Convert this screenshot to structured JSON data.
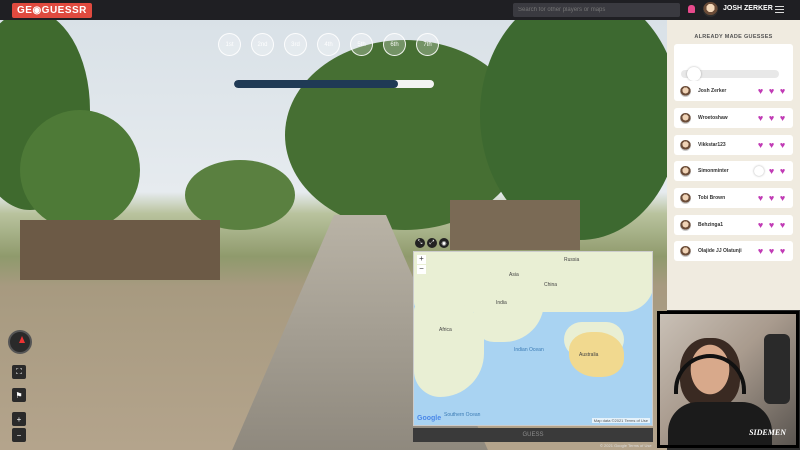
{
  "app": {
    "logo": "GE◉GUESSR",
    "search_placeholder": "Search for other players or maps",
    "username": "JOSH ZERKER"
  },
  "rounds": [
    "1st",
    "2nd",
    "3rd",
    "4th",
    "5th",
    "6th",
    "7th"
  ],
  "timer": {
    "progress": 0.82
  },
  "map": {
    "tools": [
      "⤡",
      "⤢",
      "◉"
    ],
    "zoom_in": "+",
    "zoom_out": "−",
    "labels": {
      "africa": "Africa",
      "asia": "Asia",
      "indian_ocean": "Indian Ocean",
      "australia": "Australia",
      "southern_ocean": "Southern Ocean",
      "russia": "Russia",
      "china": "China",
      "india": "India"
    },
    "google": "Google",
    "footer": "Map data ©2021   Terms of Use",
    "copyright": "© 2021 Google   Terms of Use"
  },
  "guess_button": "GUESS",
  "controls": {
    "flag": "⚑",
    "zoom_in": "+",
    "zoom_out": "−",
    "fullscreen": "⛶"
  },
  "panel": {
    "title": "ALREADY MADE GUESSES",
    "players": [
      {
        "name": "Josh Zerker",
        "hearts": 3,
        "toggle": false
      },
      {
        "name": "Wroetoshaw",
        "hearts": 3,
        "toggle": false
      },
      {
        "name": "Vikkstar123",
        "hearts": 3,
        "toggle": false
      },
      {
        "name": "Simonminter",
        "hearts": 2,
        "toggle": true
      },
      {
        "name": "Tobi Brown",
        "hearts": 3,
        "toggle": false
      },
      {
        "name": "Behzinga1",
        "hearts": 3,
        "toggle": false
      },
      {
        "name": "Olajide JJ Olatunji",
        "hearts": 3,
        "toggle": false
      }
    ]
  },
  "webcam": {
    "brand": "SIDEMEN"
  },
  "colors": {
    "heart": "#c13bb5",
    "logo_bg": "#e04a3f",
    "timer": "#1f3a55"
  }
}
